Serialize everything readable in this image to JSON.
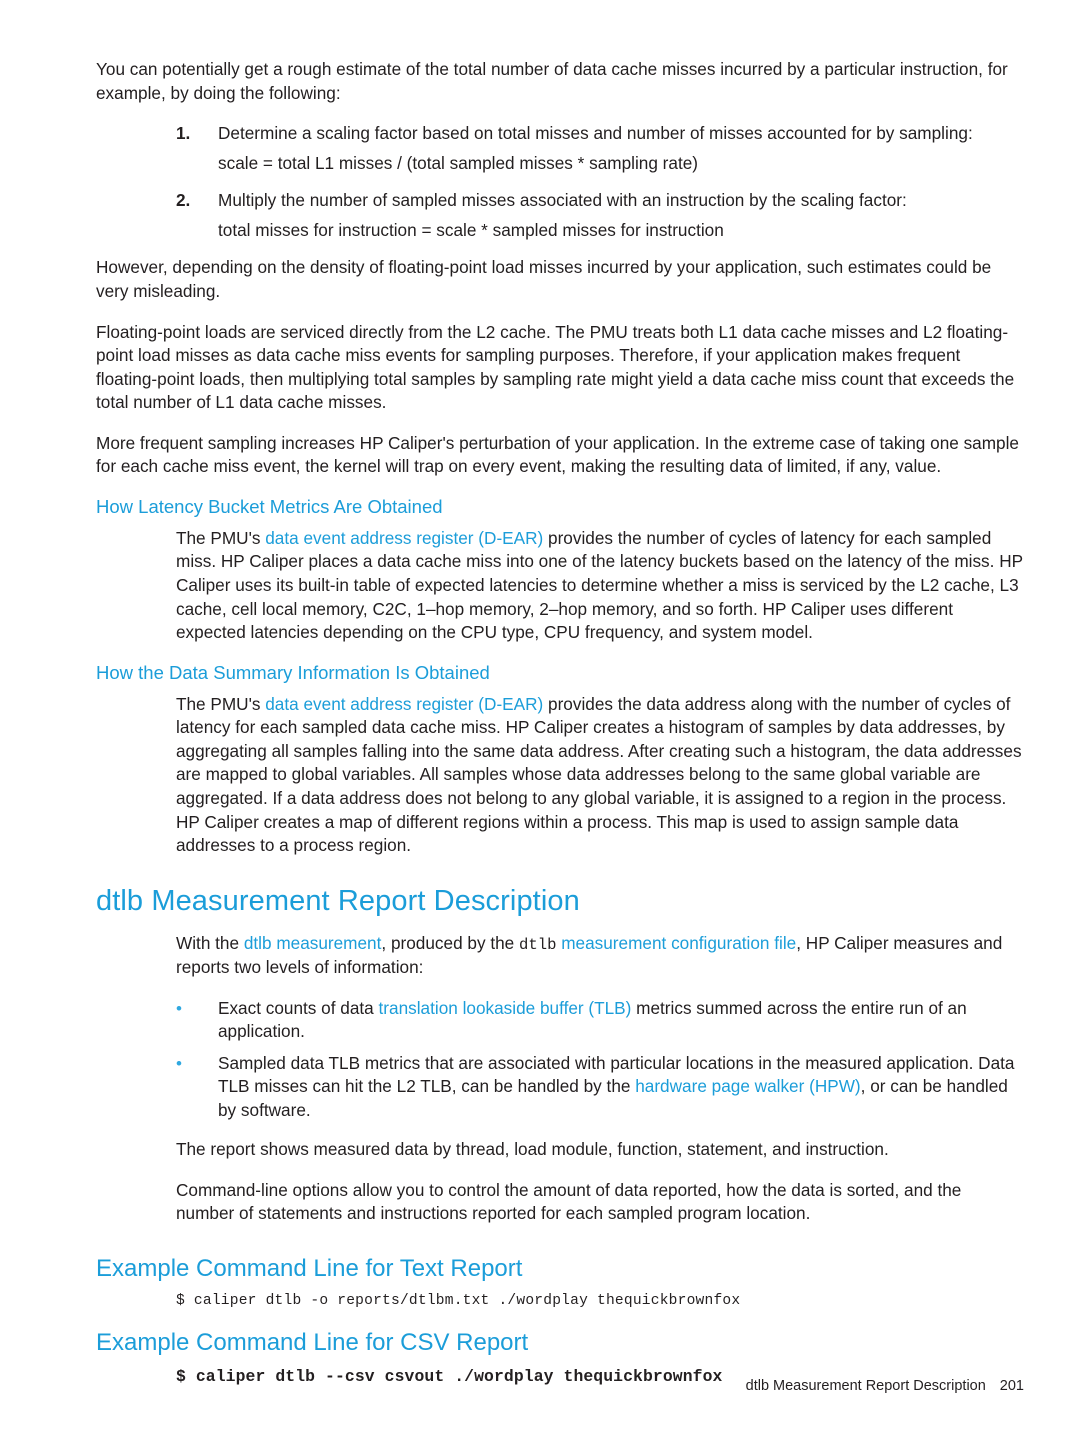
{
  "document": {
    "intro": {
      "p1": "You can potentially get a rough estimate of the total number of data cache misses incurred by a particular instruction, for example, by doing the following:",
      "steps": [
        {
          "num": "1.",
          "text": "Determine a scaling factor based on total misses and number of misses accounted for by sampling:",
          "formula": "scale = total L1 misses / (total sampled misses * sampling rate)"
        },
        {
          "num": "2.",
          "text": "Multiply the number of sampled misses associated with an instruction by the scaling factor:",
          "formula": "total misses for instruction = scale * sampled misses for instruction"
        }
      ],
      "p2": "However, depending on the density of floating-point load misses incurred by your application, such estimates could be very misleading.",
      "p3": "Floating-point loads are serviced directly from the L2 cache. The PMU treats both L1 data cache misses and L2 floating-point load misses as data cache miss events for sampling purposes. Therefore, if your application makes frequent floating-point loads, then multiplying total samples by sampling rate might yield a data cache miss count that exceeds the total number of L1 data cache misses.",
      "p4": "More frequent sampling increases HP Caliper's perturbation of your application. In the extreme case of taking one sample for each cache miss event, the kernel will trap on every event, making the resulting data of limited, if any, value."
    },
    "latency_section": {
      "heading": "How Latency Bucket Metrics Are Obtained",
      "text_a": "The PMU's ",
      "link": "data event address register (D-EAR)",
      "text_b": " provides the number of cycles of latency for each sampled miss. HP Caliper places a data cache miss into one of the latency buckets based on the latency of the miss. HP Caliper uses its built-in table of expected latencies to determine whether a miss is serviced by the L2 cache, L3 cache, cell local memory, C2C, 1–hop memory, 2–hop memory, and so forth. HP Caliper uses different expected latencies depending on the CPU type, CPU frequency, and system model."
    },
    "summary_section": {
      "heading": "How the Data Summary Information Is Obtained",
      "text_a": "The PMU's ",
      "link": "data event address register (D-EAR)",
      "text_b": " provides the data address along with the number of cycles of latency for each sampled data cache miss. HP Caliper creates a histogram of samples by data addresses, by aggregating all samples falling into the same data address. After creating such a histogram, the data addresses are mapped to global variables. All samples whose data addresses belong to the same global variable are aggregated. If a data address does not belong to any global variable, it is assigned to a region in the process. HP Caliper creates a map of different regions within a process. This map is used to assign sample data addresses to a process region."
    },
    "dtlb_section": {
      "heading": "dtlb Measurement Report Description",
      "intro_a": "With the ",
      "intro_link1": "dtlb measurement",
      "intro_b": ", produced by the ",
      "intro_mono": "dtlb",
      "intro_link2": " measurement configuration file",
      "intro_c": ", HP Caliper measures and reports two levels of information:",
      "bullets": [
        {
          "text_a": "Exact counts of data ",
          "link": "translation lookaside buffer (TLB)",
          "text_b": " metrics summed across the entire run of an application."
        },
        {
          "text_a": "Sampled data TLB metrics that are associated with particular locations in the measured application. Data TLB misses can hit the L2 TLB, can be handled by the ",
          "link": "hardware page walker (HPW)",
          "text_b": ", or can be handled by software."
        }
      ],
      "p_after_1": "The report shows measured data by thread, load module, function, statement, and instruction.",
      "p_after_2": "Command-line options allow you to control the amount of data reported, how the data is sorted, and the number of statements and instructions reported for each sampled program location."
    },
    "text_report": {
      "heading": "Example Command Line for Text Report",
      "command": "$ caliper dtlb  -o reports/dtlbm.txt ./wordplay thequickbrownfox"
    },
    "csv_report": {
      "heading": "Example Command Line for CSV Report",
      "command": "$ caliper dtlb --csv csvout ./wordplay thequickbrownfox"
    },
    "footer": {
      "title": "dtlb Measurement Report Description",
      "page": "201"
    },
    "colors": {
      "link": "#1b9dd9",
      "heading": "#1b9dd9",
      "text": "#231f20",
      "bullet": "#2fa8e0"
    }
  }
}
